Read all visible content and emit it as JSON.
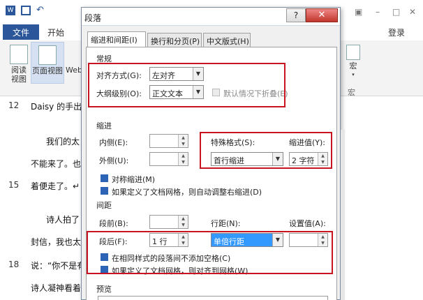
{
  "word": {
    "file_tab": "文件",
    "home_tab": "开始",
    "login": "登录",
    "ribbon": {
      "read_view": "阅读\n视图",
      "read_view_l1": "阅读",
      "read_view_l2": "视图",
      "print_layout": "页面视图",
      "web_partial": "Web",
      "macro": "宏",
      "macro_group": "宏"
    },
    "line_numbers": [
      "12",
      "15",
      "18"
    ],
    "doc_lines": [
      "Daisy 的手出去",
      "我们的太",
      "不能来了。也吃",
      "着便走了。↵",
      "诗人拍了",
      "封信，我也太懒",
      "说：“你不是有",
      "诗人凝神看着"
    ]
  },
  "dialog": {
    "title": "段落",
    "help": "?",
    "close": "✕",
    "tabs": [
      "缩进和间距(I)",
      "换行和分页(P)",
      "中文版式(H)"
    ],
    "general": {
      "section": "常规",
      "alignment_label": "对齐方式(G):",
      "alignment_value": "左对齐",
      "outline_label": "大纲级别(O):",
      "outline_value": "正文文本",
      "collapse_label": "默认情况下折叠(E)"
    },
    "indent": {
      "section": "缩进",
      "inside_label": "内侧(E):",
      "inside_value": "",
      "outside_label": "外侧(U):",
      "outside_value": "",
      "special_label": "特殊格式(S):",
      "special_value": "首行缩进",
      "by_label": "缩进值(Y):",
      "by_value": "2 字符",
      "mirror_label": "对称缩进(M)",
      "auto_adjust_label": "如果定义了文档网格，则自动调整右缩进(D)"
    },
    "spacing": {
      "section": "间距",
      "before_label": "段前(B):",
      "before_value": "",
      "after_label": "段后(F):",
      "after_value": "1 行",
      "line_label": "行距(N):",
      "line_value": "单倍行距",
      "at_label": "设置值(A):",
      "at_value": "",
      "no_space_label": "在相同样式的段落间不添加空格(C)",
      "snap_grid_label": "如果定义了文档网格，则对齐到网格(W)"
    },
    "preview": {
      "section": "预览"
    }
  },
  "colors": {
    "word_blue": "#2b579a",
    "highlight_red": "#c8141e",
    "checkbox_blue": "#2e64b5",
    "selection_blue": "#3399ff"
  }
}
